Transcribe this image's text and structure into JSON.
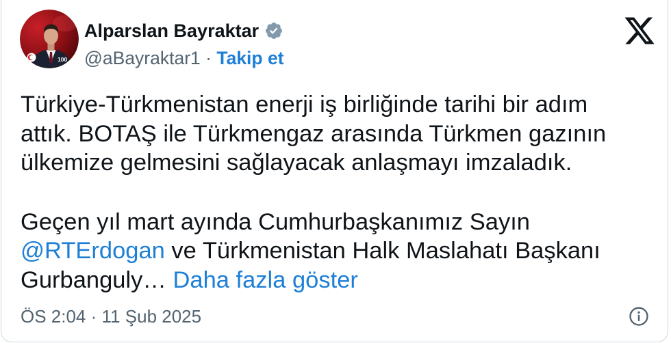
{
  "author": {
    "name": "Alparslan Bayraktar",
    "handle": "@aBayraktar1",
    "separator": "·",
    "follow_label": "Takip et",
    "avatar_logo_text": "100"
  },
  "tweet": {
    "paragraph_1": [
      "Türkiye-Türkmenistan enerji iş birliğinde tarihi bir adım",
      "attık. BOTAŞ ile Türkmengaz arasında Türkmen gazının",
      "ülkemize gelmesini sağlayacak anlaşmayı imzaladık."
    ],
    "paragraph_2": {
      "line_1": "Geçen yıl mart ayında Cumhurbaşkanımız Sayın",
      "line_2": {
        "mention": "@RTErdogan",
        "text": "ve Türkmenistan Halk Maslahatı Başkanı"
      },
      "line_3": {
        "text": "Gurbanguly…",
        "show_more": "Daha fazla göster"
      }
    }
  },
  "timestamp": {
    "time": "ÖS 2:04",
    "separator": "·",
    "date": "11 Şub 2025"
  },
  "icons": {
    "verified": "verified-badge-icon",
    "platform_logo": "x-logo-icon",
    "info": "info-icon"
  },
  "colors": {
    "background": "#ffffff",
    "text": "#0f1419",
    "secondary": "#536471",
    "link": "#1d7fd6",
    "verified_badge": "#829aab",
    "border": "#cfd9de"
  }
}
